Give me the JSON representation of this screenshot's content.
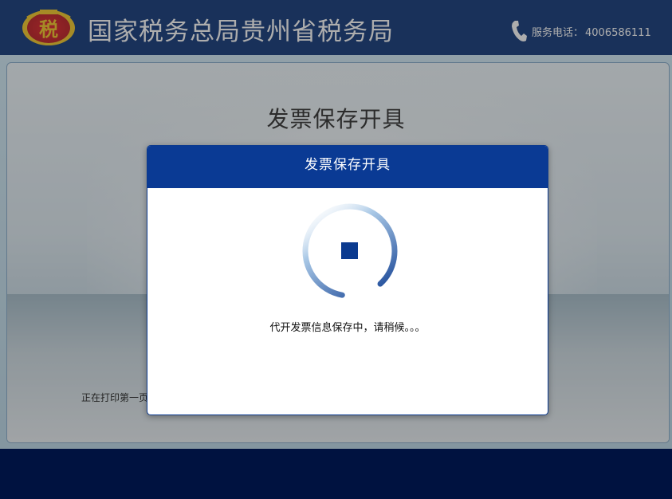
{
  "header": {
    "logo_text": "税",
    "title": "国家税务总局贵州省税务局",
    "hotline_label": "服务电话：",
    "hotline_number": "4006586111"
  },
  "page": {
    "heading": "发票保存开具",
    "print_status": "正在打印第一页"
  },
  "dialog": {
    "title": "发票保存开具",
    "message": "代开发票信息保存中，请稍候。。。"
  },
  "colors": {
    "header_bg": "#002a70",
    "dialog_header_bg": "#0a3a94",
    "spinner_accent": "#0b3a8f"
  },
  "icons": {
    "logo": "tax-emblem-icon",
    "phone": "phone-icon",
    "spinner": "loading-spinner-icon",
    "stop": "stop-icon"
  }
}
